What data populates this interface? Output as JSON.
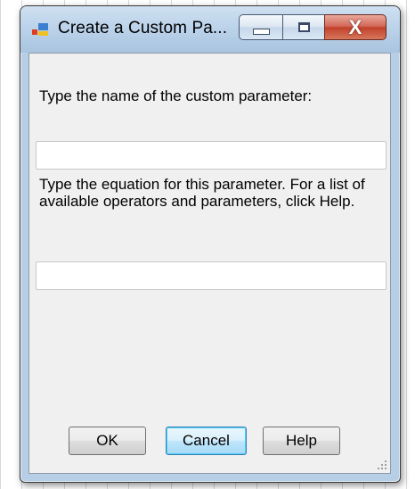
{
  "window": {
    "title": "Create a Custom Pa...",
    "controls": {
      "minimize_icon": "minimize-icon",
      "maximize_icon": "maximize-icon",
      "close_icon": "close-icon",
      "close_glyph": "X"
    },
    "app_icon": "parameter-app-icon"
  },
  "form": {
    "name_label": "Type the name of the custom parameter:",
    "name_value": "",
    "equation_label": "Type the equation for this parameter.  For a list of available operators and parameters, click Help.",
    "equation_value": ""
  },
  "buttons": {
    "ok": "OK",
    "cancel": "Cancel",
    "help": "Help"
  },
  "colors": {
    "titlebar": "#bcd3ea",
    "close_button": "#c2402b",
    "client_background": "#f0f0f0",
    "focused_button_border": "#3c7fb1"
  }
}
